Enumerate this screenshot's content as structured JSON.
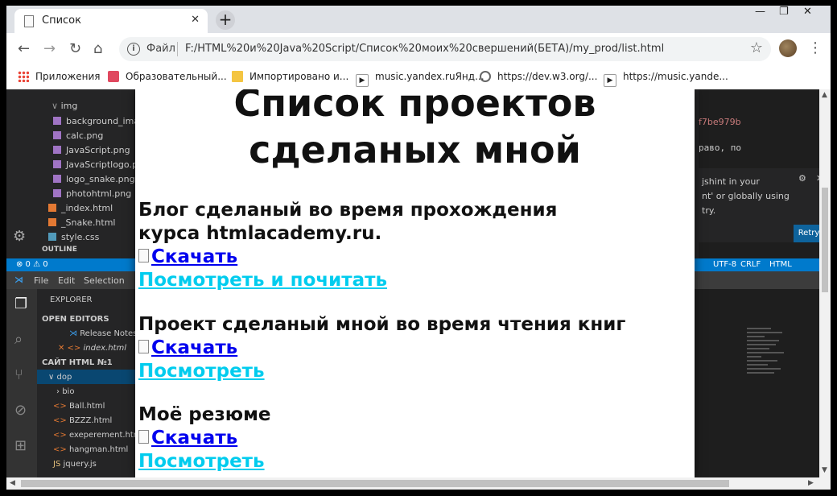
{
  "tab": {
    "title": "Список",
    "close": "✕",
    "new_tab": "+"
  },
  "window_controls": {
    "minimize": "—",
    "restore": "❐",
    "close": "✕"
  },
  "toolbar": {
    "back": "←",
    "forward": "→",
    "reload": "↻",
    "home": "⌂",
    "address_label": "Файл",
    "url": "F:/HTML%20и%20Java%20Script/Список%20моих%20свершений(БЕТА)/my_prod/list.html",
    "star": "☆",
    "menu": "⋮"
  },
  "bookmarks": [
    {
      "label": "Приложения",
      "icon": "apps-grid-icon"
    },
    {
      "label": "Образовательный...",
      "icon": "education-icon"
    },
    {
      "label": "Импортировано и...",
      "icon": "folder-icon"
    },
    {
      "label": "music.yandex.ruЯнд...",
      "icon": "play-icon"
    },
    {
      "label": "https://dev.w3.org/...",
      "icon": "globe-icon"
    },
    {
      "label": "https://music.yande...",
      "icon": "play-icon"
    }
  ],
  "page": {
    "title": "Список проектов сделаных мной",
    "sections": [
      {
        "heading": "Блог сделаный во время прохождения курса htmlacademy.ru.",
        "download": "Скачать",
        "view": "Посмотреть и почитать"
      },
      {
        "heading": "Проект сделаный мной во время чтения книг",
        "download": "Скачать",
        "view": "Посмотреть"
      },
      {
        "heading": "Моё резюме",
        "download": "Скачать",
        "view": "Посмотреть"
      }
    ]
  },
  "background_editor": {
    "tree": [
      "img",
      "background_ima",
      "calc.png",
      "JavaScript.png",
      "JavaScriptlogo.p",
      "logo_snake.png",
      "photohtml.png",
      "_index.html",
      "_Snake.html",
      "style.css"
    ],
    "outline": "OUTLINE",
    "status_left": "⊗ 0 ⚠ 0",
    "status_right": [
      "UTF-8",
      "CRLF",
      "HTML"
    ],
    "commit_hash": "f7be979b",
    "code_fragment": "раво, по",
    "notification": [
      "jshint in your",
      "nt' or globally using",
      "try."
    ],
    "retry": "Retry",
    "menu": [
      "File",
      "Edit",
      "Selection"
    ],
    "explorer_title": "EXPLORER",
    "open_editors": "OPEN EDITORS",
    "open_files": [
      "Release Notes",
      "index.html"
    ],
    "project": "САЙТ HTML №1",
    "folders": [
      "dop",
      "bio"
    ],
    "files": [
      "Ball.html",
      "BZZZ.html",
      "exeperement.htm",
      "hangman.html",
      "jquery.js"
    ]
  },
  "colors": {
    "download_link": "#0000ee",
    "view_link": "#00ccee",
    "vscode_status": "#007acc"
  }
}
